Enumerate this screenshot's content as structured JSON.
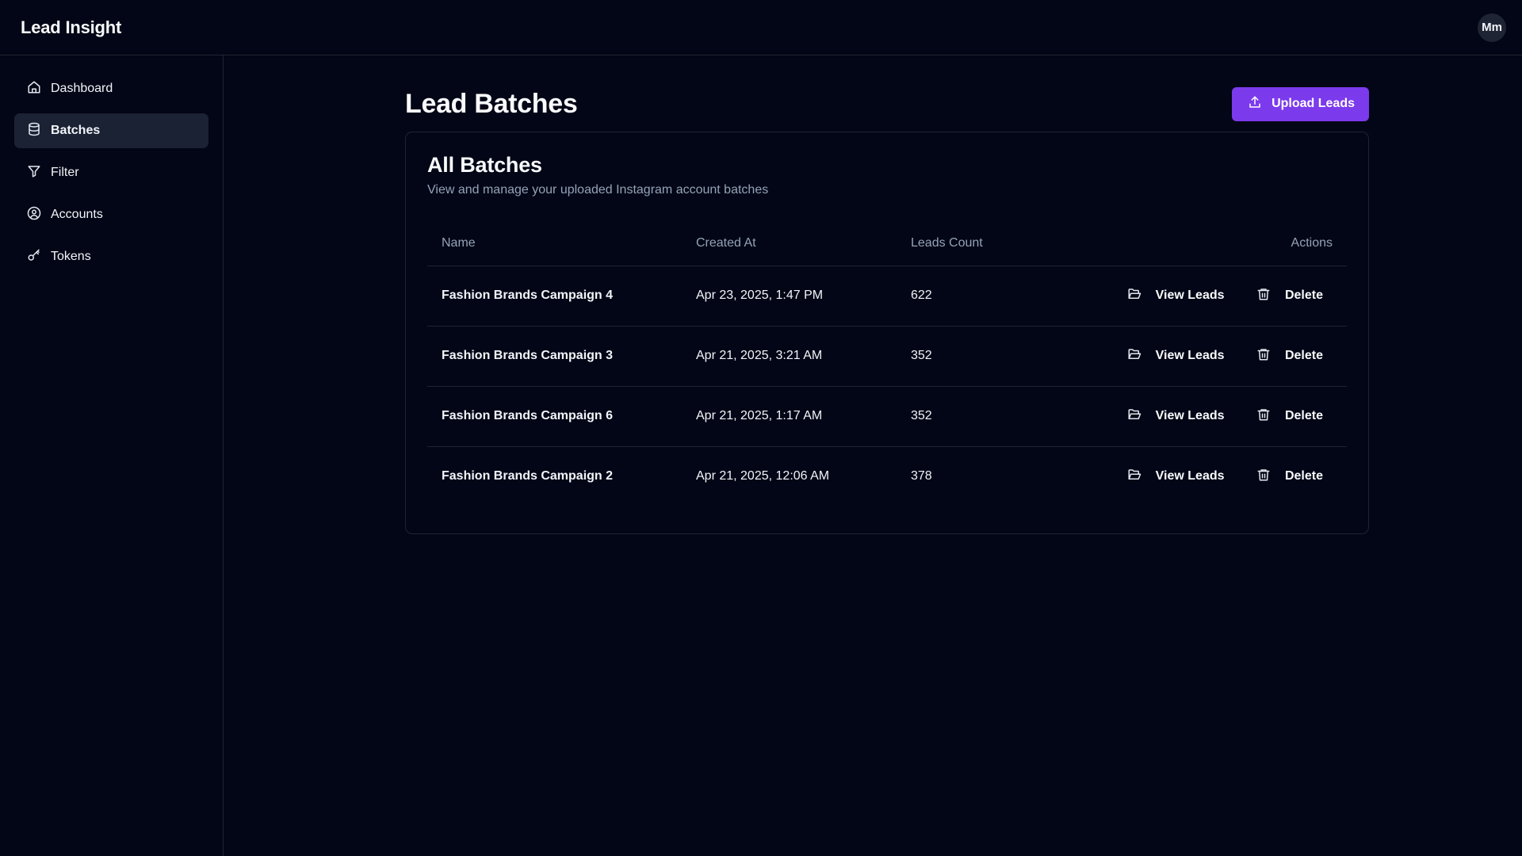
{
  "header": {
    "app_title": "Lead Insight",
    "avatar_initials": "Mm"
  },
  "sidebar": {
    "items": [
      {
        "label": "Dashboard",
        "icon": "home-icon",
        "active": false
      },
      {
        "label": "Batches",
        "icon": "database-icon",
        "active": true
      },
      {
        "label": "Filter",
        "icon": "filter-icon",
        "active": false
      },
      {
        "label": "Accounts",
        "icon": "user-circle-icon",
        "active": false
      },
      {
        "label": "Tokens",
        "icon": "key-icon",
        "active": false
      }
    ]
  },
  "main": {
    "page_title": "Lead Batches",
    "upload_label": "Upload Leads",
    "upload_icon": "upload-icon",
    "card": {
      "title": "All Batches",
      "subtitle": "View and manage your uploaded Instagram account batches"
    },
    "table": {
      "headers": {
        "name": "Name",
        "created_at": "Created At",
        "leads_count": "Leads Count",
        "actions": "Actions"
      },
      "rows": [
        {
          "name": "Fashion Brands Campaign 4",
          "created_at": "Apr 23, 2025, 1:47 PM",
          "leads_count": "622",
          "view_label": "View Leads",
          "delete_label": "Delete"
        },
        {
          "name": "Fashion Brands Campaign 3",
          "created_at": "Apr 21, 2025, 3:21 AM",
          "leads_count": "352",
          "view_label": "View Leads",
          "delete_label": "Delete"
        },
        {
          "name": "Fashion Brands Campaign 6",
          "created_at": "Apr 21, 2025, 1:17 AM",
          "leads_count": "352",
          "view_label": "View Leads",
          "delete_label": "Delete"
        },
        {
          "name": "Fashion Brands Campaign 2",
          "created_at": "Apr 21, 2025, 12:06 AM",
          "leads_count": "378",
          "view_label": "View Leads",
          "delete_label": "Delete"
        }
      ]
    }
  },
  "colors": {
    "background": "#030616",
    "accent": "#7c3aed",
    "border": "#1e2433",
    "muted_text": "#94a3b8",
    "active_nav": "#1b2233"
  }
}
